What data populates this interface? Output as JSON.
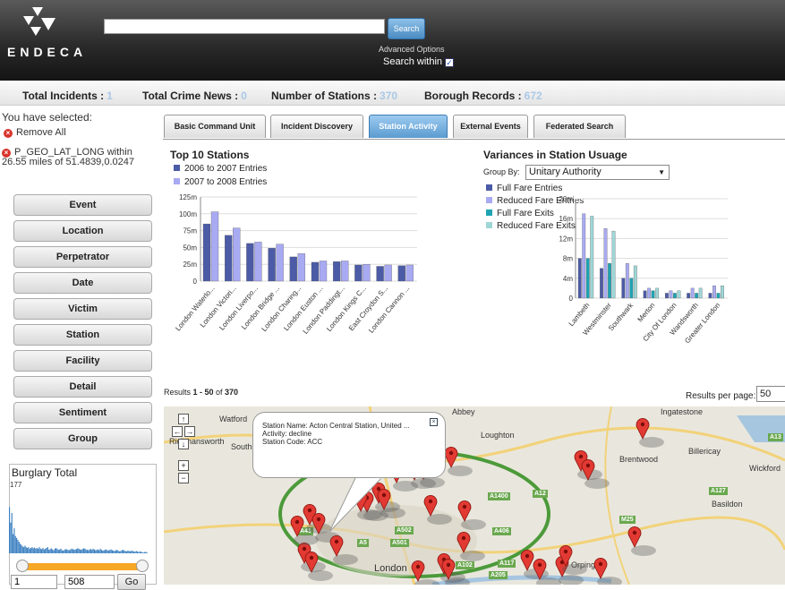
{
  "header": {
    "logo_text": "ENDECA",
    "search_placeholder": "",
    "search_button": "Search",
    "advanced_options": "Advanced Options",
    "search_within": "Search within",
    "search_within_checked": true
  },
  "stats": [
    {
      "label": "Total Incidents :",
      "value": "1"
    },
    {
      "label": "Total Crime News :",
      "value": "0"
    },
    {
      "label": "Number of Stations :",
      "value": "370"
    },
    {
      "label": "Borough Records :",
      "value": "672"
    }
  ],
  "sidebar": {
    "selected_title": "You have selected:",
    "remove_all": "Remove All",
    "geo_filter": "P_GEO_LAT_LONG within 26.55 miles of 51.4839,0.0247",
    "facets": [
      "Event",
      "Location",
      "Perpetrator",
      "Date",
      "Victim",
      "Station",
      "Facility",
      "Detail",
      "Sentiment",
      "Group"
    ],
    "burglary": {
      "title": "Burglary Total",
      "max_label": "177",
      "range_min": "1",
      "range_max": "508",
      "go": "Go",
      "histogram": [
        120,
        80,
        105,
        50,
        65,
        45,
        40,
        35,
        30,
        25,
        22,
        18,
        16,
        20,
        16,
        14,
        16,
        12,
        14,
        16,
        13,
        15,
        12,
        14,
        12,
        16,
        12,
        11,
        14,
        10,
        12,
        14,
        16,
        9,
        11,
        13,
        10,
        8,
        12,
        14,
        11,
        9,
        10,
        12,
        8,
        7,
        9,
        11,
        10,
        9,
        8,
        10,
        12,
        11,
        9,
        10,
        11,
        13,
        12,
        10,
        9,
        11,
        13,
        12,
        10,
        9,
        8,
        10,
        11,
        9,
        12,
        10,
        8,
        9,
        10,
        8,
        12,
        9,
        7,
        8,
        9,
        10,
        8,
        7,
        9,
        10,
        8,
        7,
        6,
        8,
        9,
        7,
        5,
        6,
        8,
        9,
        7,
        6,
        5,
        7,
        6,
        5,
        7,
        6,
        5,
        4,
        6,
        5,
        3,
        5,
        4,
        3,
        2,
        3,
        4,
        2
      ]
    }
  },
  "tabs": [
    {
      "label": "Basic Command Unit",
      "active": false
    },
    {
      "label": "Incident Discovery",
      "active": false
    },
    {
      "label": "Station Activity",
      "active": true
    },
    {
      "label": "External Events",
      "active": false
    },
    {
      "label": "Federated Search",
      "active": false
    }
  ],
  "chart_data": [
    {
      "type": "bar",
      "title": "Top 10 Stations",
      "categories": [
        "London Waterlo...",
        "London Victori...",
        "London Liverpo...",
        "London Bridge ...",
        "London Charing...",
        "London Euston ...",
        "London Paddingt...",
        "London Kings C...",
        "East Croydon S...",
        "London Cannon ..."
      ],
      "series": [
        {
          "name": "2006 to 2007 Entries",
          "values": [
            85,
            68,
            56,
            49,
            36,
            28,
            29,
            24,
            22,
            23
          ],
          "color": "#4c5ba6"
        },
        {
          "name": "2007 to 2008 Entries",
          "values": [
            103,
            79,
            58,
            55,
            41,
            30,
            30,
            25,
            24,
            24
          ],
          "color": "#a8aaf2"
        }
      ],
      "yticks": [
        "0",
        "25m",
        "50m",
        "75m",
        "100m",
        "125m"
      ],
      "ylim": [
        0,
        125
      ]
    },
    {
      "type": "bar",
      "title": "Variances in Station Usuage",
      "group_by_label": "Group By:",
      "group_by_value": "Unitary Authority",
      "categories": [
        "Lambeth",
        "Westminster",
        "Southwark",
        "Merton",
        "City Of London",
        "Wandsworth",
        "Greater London"
      ],
      "series": [
        {
          "name": "Full Fare Entries",
          "values": [
            8,
            6,
            4,
            1.5,
            1,
            1,
            1
          ],
          "color": "#4c5ba6"
        },
        {
          "name": "Reduced Fare Entries",
          "values": [
            17,
            14,
            7,
            2,
            1.5,
            2,
            2.5
          ],
          "color": "#a8aaf2"
        },
        {
          "name": "Full Fare Exits",
          "values": [
            8,
            7,
            4,
            1.5,
            1,
            1,
            1
          ],
          "color": "#1fa3b3"
        },
        {
          "name": "Reduced Fare Exits",
          "values": [
            16.5,
            13.5,
            6.5,
            2,
            1.5,
            2,
            2.5
          ],
          "color": "#9fd6d6"
        }
      ],
      "yticks": [
        "0",
        "4m",
        "8m",
        "12m",
        "16m",
        "20m"
      ],
      "ylim": [
        0,
        20
      ]
    }
  ],
  "results": {
    "prefix": "Results ",
    "range": "1 - 50",
    "of": " of ",
    "total": "370",
    "per_page_label": "Results per page:",
    "per_page_value": "50"
  },
  "map": {
    "popup": {
      "name": "Station Name:  Acton Central Station, United ...",
      "activity": "Activity:  decline",
      "code": "Station Code: ACC"
    },
    "place_labels": [
      "Watford",
      "Rickmansworth",
      "South Oxhey",
      "Abbey",
      "Loughton",
      "Brentwood",
      "Billericay",
      "Wickford",
      "Basildon",
      "Ingatestone",
      "London",
      "Orpington"
    ],
    "road_labels": [
      "A1400",
      "A12",
      "A406",
      "A5",
      "A501",
      "A41",
      "A502",
      "A127",
      "M25",
      "A13",
      "A117",
      "A205",
      "A102"
    ]
  }
}
